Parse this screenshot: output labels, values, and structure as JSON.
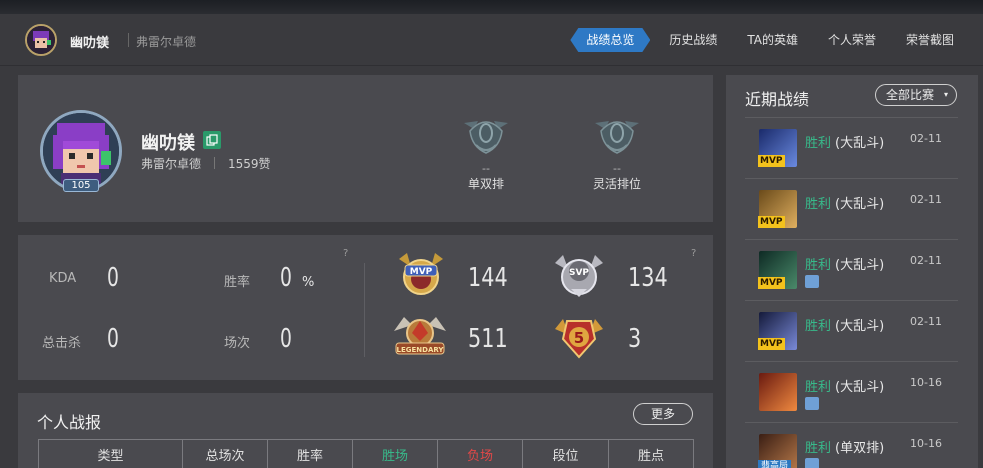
{
  "header": {
    "player_name": "幽叻镁",
    "server": "弗雷尔卓德",
    "nav": [
      "战绩总览",
      "历史战绩",
      "TA的英雄",
      "个人荣誉",
      "荣誉截图"
    ],
    "active_nav": 0
  },
  "profile": {
    "name": "幽叻镁",
    "server": "弗雷尔卓德",
    "likes": "1559赞",
    "level": "105",
    "ranks": [
      {
        "value": "--",
        "label": "单双排"
      },
      {
        "value": "--",
        "label": "灵活排位"
      }
    ]
  },
  "stats": {
    "help": "?",
    "kda_label": "KDA",
    "kda_value": "0",
    "winrate_label": "胜率",
    "winrate_value": "0",
    "winrate_unit": "%",
    "kills_label": "总击杀",
    "kills_value": "0",
    "games_label": "场次",
    "games_value": "0",
    "badges": [
      {
        "name": "mvp-badge",
        "value": "144"
      },
      {
        "name": "svp-badge",
        "value": "134"
      },
      {
        "name": "legendary-badge",
        "value": "511"
      },
      {
        "name": "pentakill-badge",
        "value": "3"
      }
    ]
  },
  "report": {
    "title": "个人战报",
    "more_label": "更多",
    "columns": [
      "类型",
      "总场次",
      "胜率",
      "胜场",
      "负场",
      "段位",
      "胜点"
    ]
  },
  "recent": {
    "title": "近期战绩",
    "filter_label": "全部比赛",
    "items": [
      {
        "result": "胜利",
        "mode": "(大乱斗)",
        "date": "02-11",
        "badge": "MVP",
        "champion_color": "#3a5ab0"
      },
      {
        "result": "胜利",
        "mode": "(大乱斗)",
        "date": "02-11",
        "badge": "MVP",
        "champion_color": "#b0883a"
      },
      {
        "result": "胜利",
        "mode": "(大乱斗)",
        "date": "02-11",
        "badge": "MVP",
        "champion_color": "#2f6a5a"
      },
      {
        "result": "胜利",
        "mode": "(大乱斗)",
        "date": "02-11",
        "badge": "MVP",
        "champion_color": "#3a4a8a"
      },
      {
        "result": "胜利",
        "mode": "(大乱斗)",
        "date": "10-16",
        "badge": "",
        "champion_color": "#b84a2a"
      },
      {
        "result": "胜利",
        "mode": "(单双排)",
        "date": "10-16",
        "badge": "翡高局",
        "champion_color": "#8a5a3a"
      }
    ]
  },
  "colors": {
    "accent": "#2e79c5",
    "win": "#38b98a",
    "loss": "#e04848",
    "mvp": "#f3c21c"
  }
}
